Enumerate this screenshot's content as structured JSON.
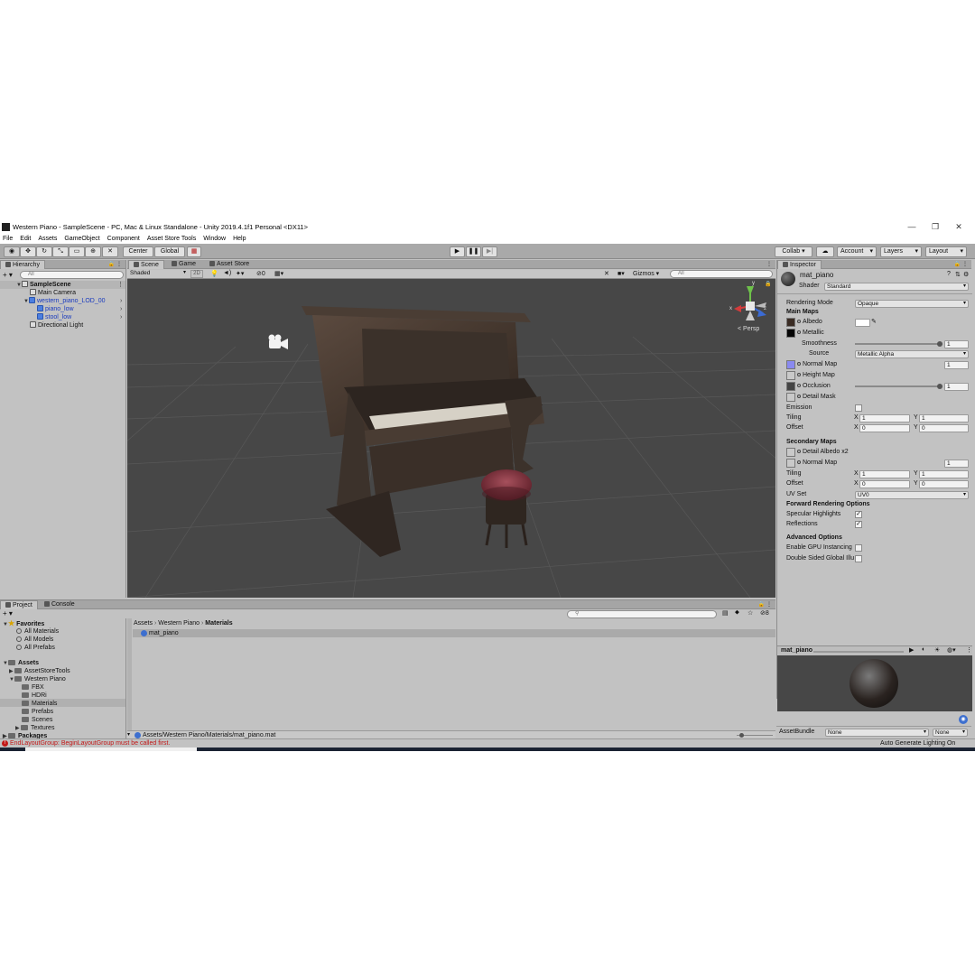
{
  "window": {
    "title": "Western Piano - SampleScene - PC, Mac & Linux Standalone - Unity 2019.4.1f1 Personal <DX11>",
    "minimize": "—",
    "restore": "❐",
    "close": "✕"
  },
  "menu": [
    "File",
    "Edit",
    "Assets",
    "GameObject",
    "Component",
    "Asset Store Tools",
    "Window",
    "Help"
  ],
  "toolbar": {
    "pivot_mode": "Center",
    "pivot_rotation": "Global",
    "collab": "Collab ▾",
    "account": "Account",
    "layers": "Layers",
    "layout": "Layout"
  },
  "hierarchy": {
    "tab": "Hierarchy",
    "search_placeholder": "All",
    "items": [
      {
        "label": "SampleScene"
      },
      {
        "label": "Main Camera"
      },
      {
        "label": "western_piano_LOD_00"
      },
      {
        "label": "piano_low"
      },
      {
        "label": "stool_low"
      },
      {
        "label": "Directional Light"
      }
    ]
  },
  "scene": {
    "tabs": [
      "Scene",
      "Game",
      "Asset Store"
    ],
    "shading_mode": "Shaded",
    "mode_2d": "2D",
    "hidden_count": "0",
    "gizmos": "Gizmos",
    "search_placeholder": "All",
    "projection_label": "< Persp",
    "axis_x": "x",
    "axis_y": "y",
    "axis_z": "z"
  },
  "project": {
    "tabs": [
      "Project",
      "Console"
    ],
    "hidden_count": "8",
    "favorites_label": "Favorites",
    "favorites": [
      "All Materials",
      "All Models",
      "All Prefabs"
    ],
    "assets_label": "Assets",
    "asset_folders": [
      {
        "label": "AssetStoreTools"
      },
      {
        "label": "Western Piano"
      },
      {
        "label": "FBX"
      },
      {
        "label": "HDRi"
      },
      {
        "label": "Materials"
      },
      {
        "label": "Prefabs"
      },
      {
        "label": "Scenes"
      },
      {
        "label": "Textures"
      }
    ],
    "packages_label": "Packages",
    "breadcrumb": [
      "Assets",
      "Western Piano",
      "Materials"
    ],
    "selected_file": "mat_piano",
    "path": "Assets/Western Piano/Materials/mat_piano.mat"
  },
  "inspector": {
    "tab": "Inspector",
    "material_name": "mat_piano",
    "shader_label": "Shader",
    "shader_value": "Standard",
    "rendering_mode_label": "Rendering Mode",
    "rendering_mode_value": "Opaque",
    "main_maps": "Main Maps",
    "albedo": "Albedo",
    "metallic": "Metallic",
    "smoothness": "Smoothness",
    "smoothness_value": "1",
    "source_label": "Source",
    "source_value": "Metallic Alpha",
    "normal_map": "Normal Map",
    "normal_map_value": "1",
    "height_map": "Height Map",
    "occlusion": "Occlusion",
    "occlusion_value": "1",
    "detail_mask": "Detail Mask",
    "emission": "Emission",
    "tiling": "Tiling",
    "offset": "Offset",
    "x_label": "X",
    "y_label": "Y",
    "main_tiling": {
      "x": "1",
      "y": "1"
    },
    "main_offset": {
      "x": "0",
      "y": "0"
    },
    "secondary_maps": "Secondary Maps",
    "detail_albedo": "Detail Albedo x2",
    "detail_normal": "Normal Map",
    "detail_normal_value": "1",
    "sec_tiling": {
      "x": "1",
      "y": "1"
    },
    "sec_offset": {
      "x": "0",
      "y": "0"
    },
    "uv_set_label": "UV Set",
    "uv_set_value": "UV0",
    "forward_rendering": "Forward Rendering Options",
    "specular_highlights": "Specular Highlights",
    "reflections": "Reflections",
    "advanced_options": "Advanced Options",
    "gpu_instancing": "Enable GPU Instancing",
    "double_sided_gi": "Double Sided Global Illu",
    "preview_title": "mat_piano",
    "assetbundle_label": "AssetBundle",
    "assetbundle_value": "None",
    "assetbundle_variant": "None",
    "checkmark": "✓",
    "metallic_alpha_source": "Metallic Alpha"
  },
  "status": {
    "error": "EndLayoutGroup: BeginLayoutGroup must be called first.",
    "lighting": "Auto Generate Lighting On"
  },
  "colors": {
    "error_text": "#c21818",
    "selection_blue": "#1a3bbf",
    "scene_bg": "#474747",
    "normal_map_swatch": "#8a8af0"
  }
}
